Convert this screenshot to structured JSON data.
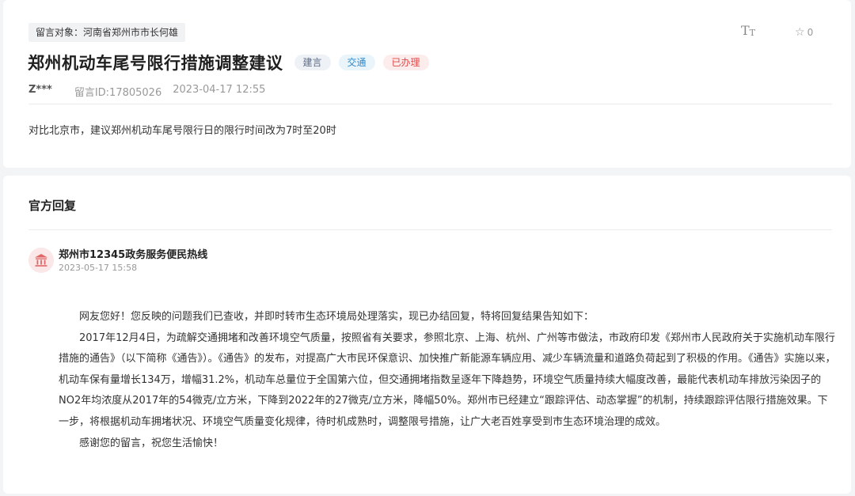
{
  "message": {
    "target_label": "留言对象：河南省郑州市市长何雄",
    "title": "郑州机动车尾号限行措施调整建议",
    "tags": [
      "建言",
      "交通"
    ],
    "status": "已办理",
    "author": "Z***",
    "message_id": "留言ID:17805026",
    "datetime": "2023-04-17 12:55",
    "content": "对比北京市，建议郑州机动车尾号限行日的限行时间改为7时至20时",
    "star_count": "0"
  },
  "reply": {
    "section_title": "官方回复",
    "org_name": "郑州市12345政务服务便民热线",
    "datetime": "2023-05-17 15:58",
    "paragraphs": [
      "网友您好！您反映的问题我们已查收，并即时转市生态环境局处理落实，现已办结回复，特将回复结果告知如下：",
      "2017年12月4日，为疏解交通拥堵和改善环境空气质量，按照省有关要求，参照北京、上海、杭州、广州等市做法，市政府印发《郑州市人民政府关于实施机动车限行措施的通告》（以下简称《通告》）。《通告》的发布，对提高广大市民环保意识、加快推广新能源车辆应用、减少车辆流量和道路负荷起到了积极的作用。《通告》实施以来，机动车保有量增长134万，增幅31.2%，机动车总量位于全国第六位，但交通拥堵指数呈逐年下降趋势，环境空气质量持续大幅度改善，最能代表机动车排放污染因子的NO2年均浓度从2017年的54微克/立方米，下降到2022年的27微克/立方米，降幅50%。郑州市已经建立“跟踪评估、动态掌握”的机制，持续跟踪评估限行措施效果。下一步，将根据机动车拥堵状况、环境空气质量变化规律，待时机成熟时，调整限号措施，让广大老百姓享受到市生态环境治理的成效。",
      "感谢您的留言，祝您生活愉快！"
    ]
  },
  "icons": {
    "font_size": "font-size-icon",
    "star": "star-icon",
    "org": "government-building-icon"
  },
  "colors": {
    "status_text": "#e04848",
    "status_bg": "#fdecec",
    "tag_blue": "#2f89c9",
    "avatar_bg": "#fbe7e7",
    "avatar_icon": "#e06767"
  }
}
